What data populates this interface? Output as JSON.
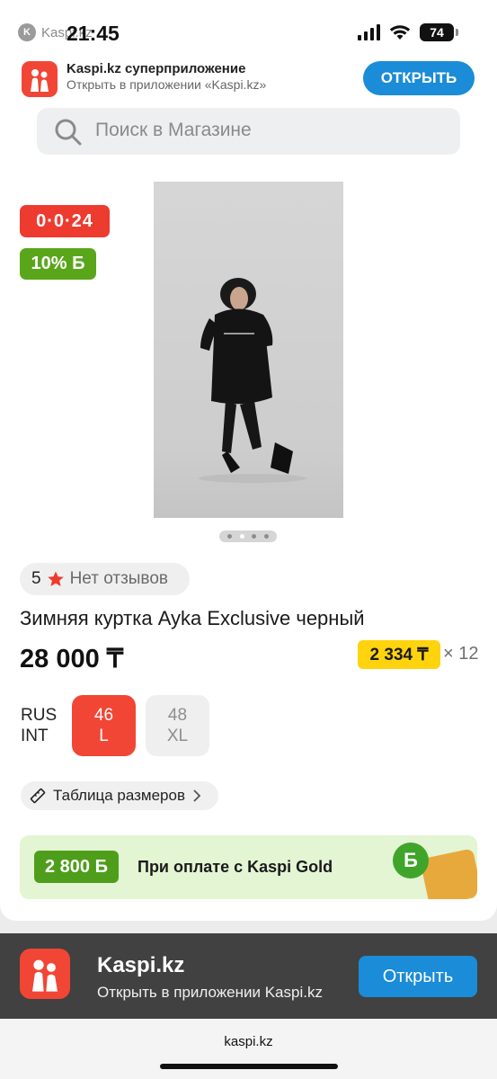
{
  "status_bar": {
    "time": "21:45",
    "back_app": "Kaspi.kz",
    "battery": "74"
  },
  "smart_banner": {
    "title": "Kaspi.kz суперприложение",
    "subtitle": "Открыть в приложении «Kaspi.kz»",
    "button": "ОТКРЫТЬ"
  },
  "search": {
    "placeholder": "Поиск в Магазине"
  },
  "product": {
    "timer": "0·0·24",
    "bonus_badge": "10% Б",
    "photo_pages": 4,
    "photo_active_page": 2,
    "rating": "5",
    "reviews": "Нет отзывов",
    "title": "Зимняя куртка Ayka Exclusive черный",
    "price": "28 000 ₸",
    "installment_amount": "2 334 ₸",
    "installment_term": "× 12",
    "size_systems": [
      "RUS",
      "INT"
    ],
    "sizes": [
      {
        "rus": "46",
        "int": "L",
        "selected": true
      },
      {
        "rus": "48",
        "int": "XL",
        "selected": false
      }
    ],
    "size_chart_label": "Таблица размеров"
  },
  "gold_banner": {
    "amount": "2 800 Б",
    "text": "При оплате с Kaspi Gold"
  },
  "app_banner": {
    "title": "Kaspi.kz",
    "subtitle": "Открыть в приложении Kaspi.kz",
    "button": "Открыть"
  },
  "url": "kaspi.kz",
  "colors": {
    "kaspi_red": "#f14635",
    "accent_blue": "#1a8cd8",
    "bonus_green": "#5aa61b",
    "installment_yellow": "#ffd30d"
  }
}
